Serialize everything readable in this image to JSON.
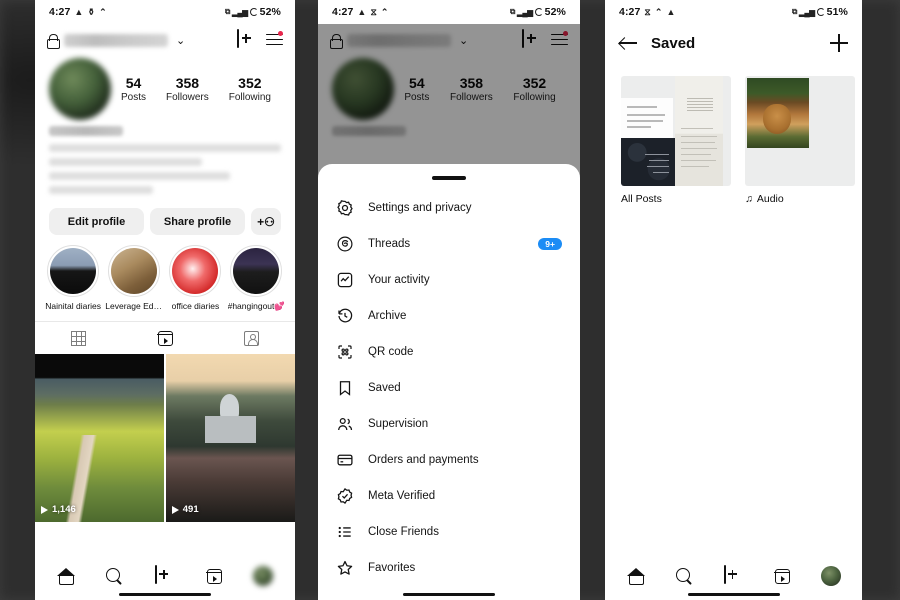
{
  "status_bar": {
    "time": "4:27",
    "battery_left": "52%",
    "battery_right": "51%",
    "glyph_alarm": "▲",
    "glyph_vibrate": "⚡",
    "glyph_caret": "︿",
    "glyph_sim": "◼",
    "glyph_signal": "▮▮▮"
  },
  "profile": {
    "lock_icon": "lock-icon",
    "chevron": "⌄",
    "add_icon": "plus-square-icon",
    "menu_icon": "hamburger-menu-icon",
    "stats": [
      {
        "num": "54",
        "label": "Posts"
      },
      {
        "num": "358",
        "label": "Followers"
      },
      {
        "num": "352",
        "label": "Following"
      }
    ],
    "actions": {
      "edit": "Edit profile",
      "share": "Share profile",
      "add_person": "+⚇"
    },
    "highlights": [
      {
        "caption": "Nainital diaries"
      },
      {
        "caption": "Leverage Edu ..."
      },
      {
        "caption": "office diaries"
      },
      {
        "caption": "#hangingout💕"
      }
    ],
    "tabs": [
      {
        "name": "grid-tab"
      },
      {
        "name": "reels-tab"
      },
      {
        "name": "tagged-tab"
      }
    ],
    "posts": [
      {
        "views": "1,146"
      },
      {
        "views": "491"
      }
    ]
  },
  "menu_sheet": {
    "items": [
      {
        "label": "Settings and privacy",
        "icon": "settings-gear-icon",
        "badge": ""
      },
      {
        "label": "Threads",
        "icon": "threads-icon",
        "badge": "9+"
      },
      {
        "label": "Your activity",
        "icon": "activity-chart-icon",
        "badge": ""
      },
      {
        "label": "Archive",
        "icon": "archive-clock-icon",
        "badge": ""
      },
      {
        "label": "QR code",
        "icon": "qr-code-icon",
        "badge": ""
      },
      {
        "label": "Saved",
        "icon": "bookmark-icon",
        "badge": ""
      },
      {
        "label": "Supervision",
        "icon": "supervision-people-icon",
        "badge": ""
      },
      {
        "label": "Orders and payments",
        "icon": "credit-card-icon",
        "badge": ""
      },
      {
        "label": "Meta Verified",
        "icon": "verified-check-icon",
        "badge": ""
      },
      {
        "label": "Close Friends",
        "icon": "list-icon",
        "badge": ""
      },
      {
        "label": "Favorites",
        "icon": "star-icon",
        "badge": ""
      }
    ]
  },
  "saved_screen": {
    "title": "Saved",
    "back_icon": "back-arrow-icon",
    "add_icon": "plus-icon",
    "collections": [
      {
        "name": "All Posts",
        "prefix": ""
      },
      {
        "name": "Audio",
        "prefix": "♫"
      }
    ]
  },
  "bottom_nav": {
    "home": "home-icon",
    "search": "search-icon",
    "create": "create-plus-icon",
    "reels": "reels-icon",
    "profile": "profile-avatar"
  },
  "colors": {
    "badge_blue": "#1c8cf5",
    "notification_red": "#e8254b",
    "backdrop": "#3d3d3d"
  }
}
